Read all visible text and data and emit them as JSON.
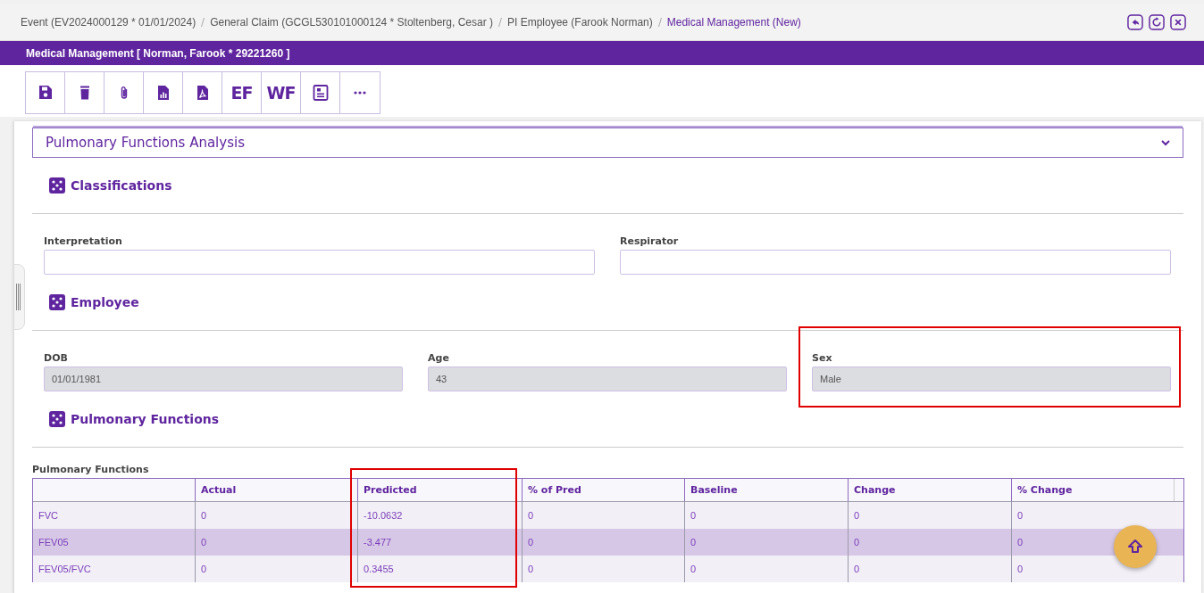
{
  "breadcrumb": [
    {
      "label": "Event (EV2024000129 * 01/01/2024)",
      "current": false
    },
    {
      "label": "General Claim (GCGL530101000124 * Stoltenberg, Cesar )",
      "current": false
    },
    {
      "label": "PI Employee (Farook Norman)",
      "current": false
    },
    {
      "label": "Medical Management (New)",
      "current": true
    }
  ],
  "window_actions": [
    {
      "kind": "back"
    },
    {
      "kind": "refresh"
    },
    {
      "kind": "close"
    }
  ],
  "title_bar": {
    "title": "Medical Management [ Norman, Farook * 29221260 ]"
  },
  "toolbar": [
    {
      "kind": "save"
    },
    {
      "kind": "delete"
    },
    {
      "kind": "attach"
    },
    {
      "kind": "report"
    },
    {
      "kind": "pdf"
    },
    {
      "kind": "text",
      "label": "EF"
    },
    {
      "kind": "text",
      "label": "WF"
    },
    {
      "kind": "card"
    },
    {
      "kind": "more"
    }
  ],
  "panel": {
    "title": "Pulmonary Functions Analysis",
    "groups": [
      {
        "heading": "Classifications",
        "fields": [
          {
            "label": "Interpretation",
            "disabled": false
          },
          {
            "label": "Respirator",
            "disabled": false
          }
        ]
      },
      {
        "heading": "Employee",
        "fields": [
          {
            "label": "DOB",
            "value": "01/01/1981",
            "disabled": true
          },
          {
            "label": "Age",
            "value": "43",
            "disabled": true
          },
          {
            "label": "Sex",
            "value": "Male",
            "disabled": true,
            "highlighted": true
          }
        ]
      },
      {
        "heading": "Pulmonary Functions"
      }
    ]
  },
  "table": {
    "title": "Pulmonary Functions",
    "columns": [
      {},
      {
        "label": "Actual"
      },
      {
        "label": "Predicted",
        "highlighted": true
      },
      {
        "label": "% of Pred"
      },
      {
        "label": "Baseline"
      },
      {
        "label": "Change"
      },
      {
        "label": "% Change"
      }
    ],
    "rows": [
      {
        "cells": [
          "FVC",
          "0",
          "-10.0632",
          "0",
          "0",
          "0",
          "0"
        ]
      },
      {
        "cells": [
          "FEV05",
          "0",
          "-3.477",
          "0",
          "0",
          "0",
          "0"
        ]
      },
      {
        "cells": [
          "FEV05/FVC",
          "0",
          "0.3455",
          "0",
          "0",
          "0",
          "0"
        ]
      }
    ]
  }
}
